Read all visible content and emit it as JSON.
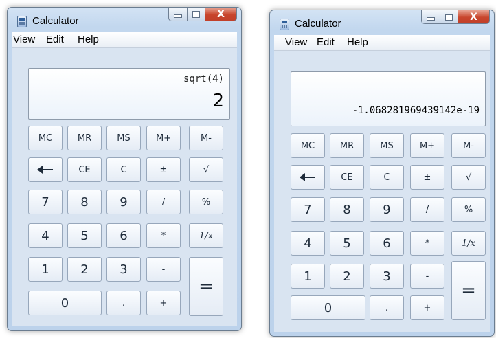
{
  "window1": {
    "title": "Calculator",
    "controls": {
      "minimize": "minimize",
      "maximize": "maximize",
      "close": "X"
    },
    "menu": [
      "View",
      "Edit",
      "Help"
    ],
    "display": {
      "expression": "sqrt(4)",
      "value": "2"
    }
  },
  "window2": {
    "title": "Calculator",
    "controls": {
      "minimize": "minimize",
      "maximize": "maximize",
      "close": "X"
    },
    "menu": [
      "View",
      "Edit",
      "Help"
    ],
    "display": {
      "expression": "",
      "value": "-1.068281969439142e-19"
    }
  },
  "keys": {
    "mc": "MC",
    "mr": "MR",
    "ms": "MS",
    "mplus": "M+",
    "mminus": "M-",
    "backspace_icon": "arrow-left-icon",
    "ce": "CE",
    "c": "C",
    "plusminus": "±",
    "sqrt": "√",
    "d7": "7",
    "d8": "8",
    "d9": "9",
    "divide": "/",
    "percent": "%",
    "d4": "4",
    "d5": "5",
    "d6": "6",
    "multiply": "*",
    "reciprocal": "1/x",
    "d1": "1",
    "d2": "2",
    "d3": "3",
    "minus": "-",
    "equals": "=",
    "d0": "0",
    "decimal": ".",
    "plus": "+"
  },
  "colors": {
    "title_bar": "#c2d7ee",
    "close_button": "#c8452c",
    "display_bg": "#ffffff",
    "key_border": "#97a7bb"
  }
}
